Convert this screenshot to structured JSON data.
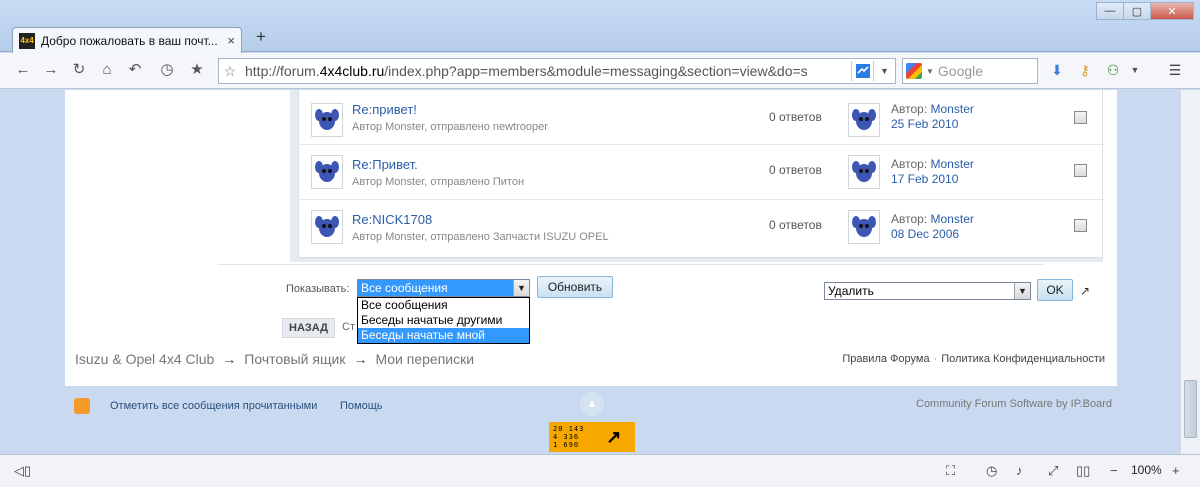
{
  "browser": {
    "tab_title": "Добро пожаловать в ваш почт...",
    "tab_favicon": "4x4",
    "tab_close": "×",
    "new_tab": "+",
    "window_buttons": [
      "—",
      "▢",
      "✕"
    ],
    "url_prefix": "http://forum.",
    "url_domain": "4x4club.ru",
    "url_rest": "/index.php?app=members&module=messaging&section=view&do=s",
    "search_placeholder": "Google",
    "zoom_level": "100%",
    "icons": [
      "back-icon",
      "forward-icon",
      "reload-icon",
      "home-icon",
      "undo-icon",
      "history-icon",
      "bookmark-star-icon",
      "page-star-icon",
      "extension-icon",
      "dropdown-icon",
      "download-icon",
      "key-icon",
      "user-icon",
      "menu-icon"
    ]
  },
  "messages": [
    {
      "subject": "Re:привет!",
      "meta": "Автор Monster, отправлено newtrooper",
      "replies": "0 ответов",
      "author_label": "Автор:",
      "author": "Monster",
      "date": "25 Feb 2010"
    },
    {
      "subject": "Re:Привет.",
      "meta": "Автор Monster, отправлено Питон",
      "replies": "0 ответов",
      "author_label": "Автор:",
      "author": "Monster",
      "date": "17 Feb 2010"
    },
    {
      "subject": "Re:NICK1708",
      "meta": "Автор Monster, отправлено Запчасти ISUZU OPEL",
      "replies": "0 ответов",
      "author_label": "Автор:",
      "author": "Monster",
      "date": "08 Dec 2006"
    }
  ],
  "controls": {
    "show_label": "Показывать:",
    "filter_selected": "Все сообщения",
    "filter_options": [
      "Все сообщения",
      "Беседы начатые другими",
      "Беседы начатые мной"
    ],
    "filter_highlighted_index": 2,
    "refresh_label": "Обновить",
    "action_selected": "Удалить",
    "ok_label": "OK",
    "back_label": "НАЗАД",
    "cut_text": "Ст"
  },
  "breadcrumb": {
    "items": [
      "Isuzu & Opel 4x4 Club",
      "Почтовый ящик",
      "Мои переписки"
    ],
    "separator": "→"
  },
  "footer": {
    "rules": "Правила Форума",
    "privacy": "Политика Конфиденциальности",
    "dot": "·",
    "mark_read": "Отметить все сообщения прочитанными",
    "help": "Помощь",
    "powered": "Community Forum Software by IP.Board",
    "counter_lines": [
      "20 143",
      "4 336",
      "1 690"
    ]
  },
  "colors": {
    "link": "#2a5ea8",
    "selection": "#3399ff",
    "counter_bg": "#f6a800",
    "page_bg": "#c9daf0"
  }
}
